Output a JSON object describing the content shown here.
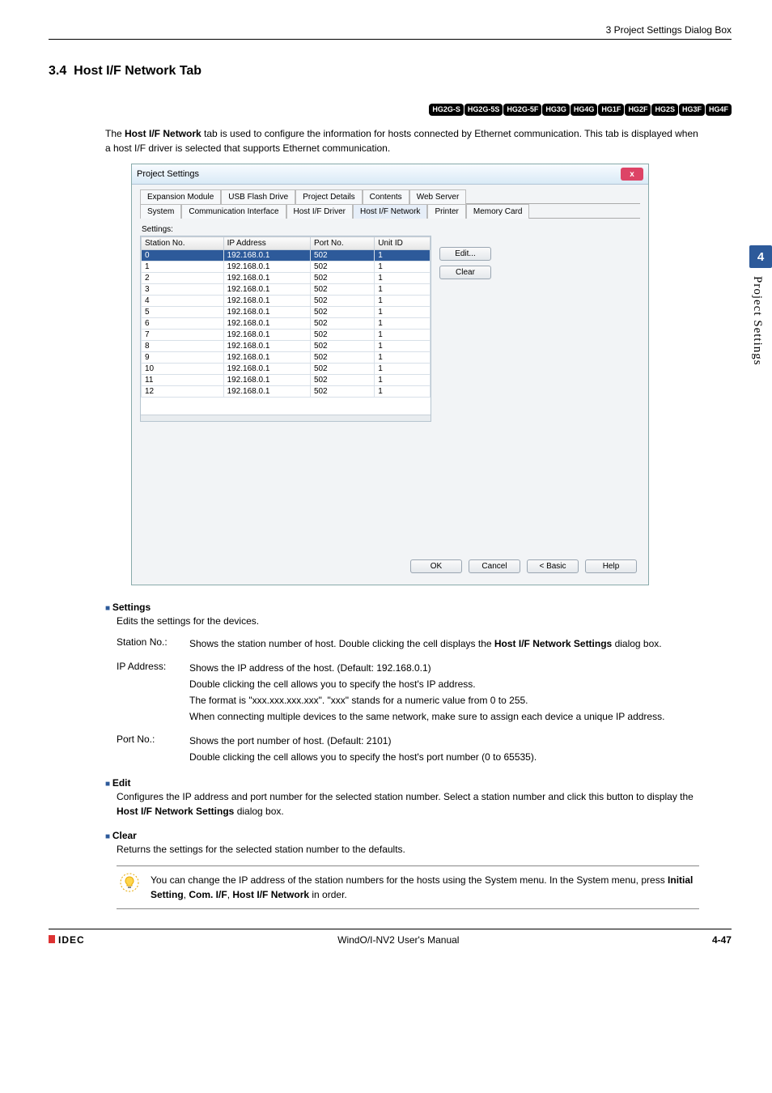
{
  "header": {
    "breadcrumb": "3 Project Settings Dialog Box"
  },
  "sidetab": {
    "number": "4",
    "label": "Project Settings"
  },
  "section": {
    "number": "3.4",
    "title": "Host I/F Network Tab"
  },
  "badges": [
    "HG2G-S",
    "HG2G-5S",
    "HG2G-5F",
    "HG3G",
    "HG4G",
    "HG1F",
    "HG2F",
    "HG2S",
    "HG3F",
    "HG4F"
  ],
  "intro": {
    "line1_a": "The ",
    "line1_b": "Host I/F Network",
    "line1_c": " tab is used to configure the information for hosts connected by Ethernet communication. This tab is displayed when a host I/F driver is selected that supports Ethernet communication."
  },
  "dialog": {
    "title": "Project Settings",
    "close": "x",
    "tabs_row1": [
      "Expansion Module",
      "USB Flash Drive",
      "Project Details",
      "Contents",
      "Web Server"
    ],
    "tabs_row2": [
      "System",
      "Communication Interface",
      "Host I/F Driver",
      "Host I/F Network",
      "Printer",
      "Memory Card"
    ],
    "active_tab": "Host I/F Network",
    "settings_label": "Settings:",
    "columns": [
      "Station No.",
      "IP Address",
      "Port No.",
      "Unit ID"
    ],
    "rows": [
      {
        "sn": "0",
        "ip": "192.168.0.1",
        "port": "502",
        "uid": "1",
        "sel": true
      },
      {
        "sn": "1",
        "ip": "192.168.0.1",
        "port": "502",
        "uid": "1"
      },
      {
        "sn": "2",
        "ip": "192.168.0.1",
        "port": "502",
        "uid": "1"
      },
      {
        "sn": "3",
        "ip": "192.168.0.1",
        "port": "502",
        "uid": "1"
      },
      {
        "sn": "4",
        "ip": "192.168.0.1",
        "port": "502",
        "uid": "1"
      },
      {
        "sn": "5",
        "ip": "192.168.0.1",
        "port": "502",
        "uid": "1"
      },
      {
        "sn": "6",
        "ip": "192.168.0.1",
        "port": "502",
        "uid": "1"
      },
      {
        "sn": "7",
        "ip": "192.168.0.1",
        "port": "502",
        "uid": "1"
      },
      {
        "sn": "8",
        "ip": "192.168.0.1",
        "port": "502",
        "uid": "1"
      },
      {
        "sn": "9",
        "ip": "192.168.0.1",
        "port": "502",
        "uid": "1"
      },
      {
        "sn": "10",
        "ip": "192.168.0.1",
        "port": "502",
        "uid": "1"
      },
      {
        "sn": "11",
        "ip": "192.168.0.1",
        "port": "502",
        "uid": "1"
      },
      {
        "sn": "12",
        "ip": "192.168.0.1",
        "port": "502",
        "uid": "1"
      }
    ],
    "side_buttons": {
      "edit": "Edit...",
      "clear": "Clear"
    },
    "footer_buttons": {
      "ok": "OK",
      "cancel": "Cancel",
      "basic": "< Basic",
      "help": "Help"
    }
  },
  "sections": {
    "settings": {
      "head": "Settings",
      "body": "Edits the settings for the devices."
    },
    "defs": {
      "station": {
        "term": "Station No.:",
        "l1a": "Shows the station number of host. Double clicking the cell displays the ",
        "l1b": "Host I/F Network Settings",
        "l1c": " dialog box."
      },
      "ip": {
        "term": "IP Address:",
        "l1": "Shows the IP address of the host. (Default: 192.168.0.1)",
        "l2": "Double clicking the cell allows you to specify the host's IP address.",
        "l3": "The format is \"xxx.xxx.xxx.xxx\". \"xxx\" stands for a numeric value from 0 to 255.",
        "l4": "When connecting multiple devices to the same network, make sure to assign each device a unique IP address."
      },
      "port": {
        "term": "Port No.:",
        "l1": "Shows the port number of host. (Default: 2101)",
        "l2": "Double clicking the cell allows you to specify the host's port number (0 to 65535)."
      }
    },
    "edit": {
      "head": "Edit",
      "body_a": "Configures the IP address and port number for the selected station number. Select a station number and click this button to display the ",
      "body_b": "Host I/F Network Settings",
      "body_c": " dialog box."
    },
    "clear": {
      "head": "Clear",
      "body": "Returns the settings for the selected station number to the defaults."
    }
  },
  "tip": {
    "text_a": "You can change the IP address of the station numbers for the hosts using the System menu. In the System menu, press ",
    "b1": "Initial Setting",
    "c1": ", ",
    "b2": "Com. I/F",
    "c2": ", ",
    "b3": "Host I/F Network",
    "c3": " in order."
  },
  "footer": {
    "brand": "IDEC",
    "center": "WindO/I-NV2 User's Manual",
    "page": "4-47"
  }
}
